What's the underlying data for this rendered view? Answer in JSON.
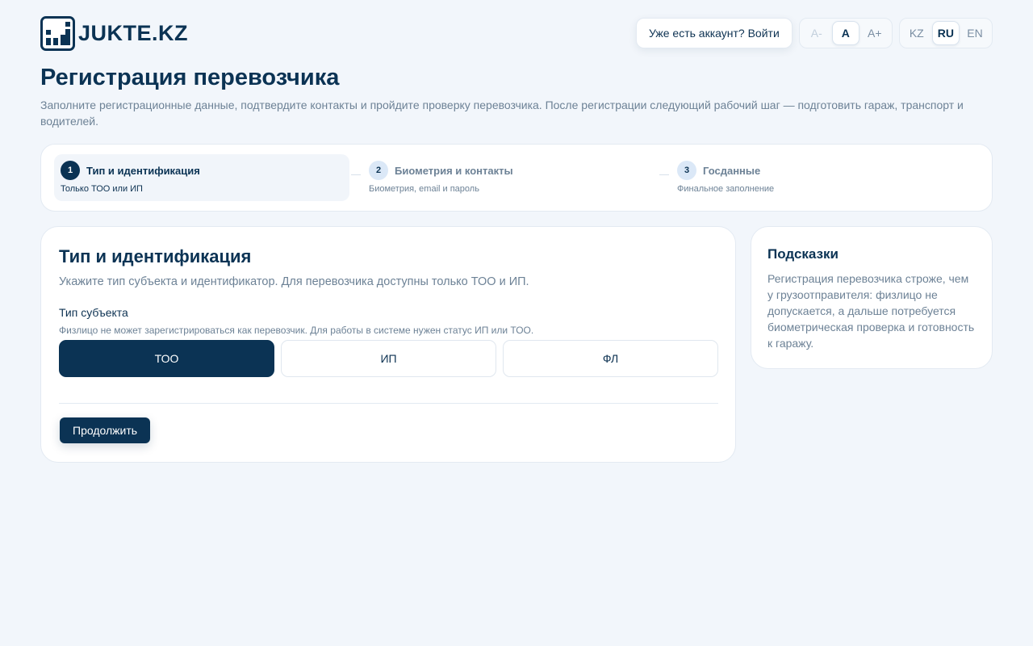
{
  "header": {
    "logo_text": "JUKTE.KZ",
    "login_label": "Уже есть аккаунт? Войти",
    "font_size": {
      "options": [
        "A-",
        "A",
        "A+"
      ],
      "selected": "A"
    },
    "language": {
      "options": [
        "KZ",
        "RU",
        "EN"
      ],
      "selected": "RU"
    }
  },
  "page": {
    "title": "Регистрация перевозчика",
    "description": "Заполните регистрационные данные, подтвердите контакты и пройдите проверку перевозчика. После регистрации следующий рабочий шаг — подготовить гараж, транспорт и водителей."
  },
  "stepper": {
    "steps": [
      {
        "number": "1",
        "title": "Тип и идентификация",
        "subtitle": "Только ТОО или ИП",
        "active": true
      },
      {
        "number": "2",
        "title": "Биометрия и контакты",
        "subtitle": "Биометрия, email и пароль",
        "active": false
      },
      {
        "number": "3",
        "title": "Госданные",
        "subtitle": "Финальное заполнение",
        "active": false
      }
    ]
  },
  "form": {
    "title": "Тип и идентификация",
    "description": "Укажите тип субъекта и идентификатор. Для перевозчика доступны только ТОО и ИП.",
    "subject_type": {
      "label": "Тип субъекта",
      "hint": "Физлицо не может зарегистрироваться как перевозчик. Для работы в системе нужен статус ИП или ТОО.",
      "options": [
        "ТОО",
        "ИП",
        "ФЛ"
      ],
      "selected": "ТОО"
    },
    "continue_label": "Продолжить"
  },
  "hints": {
    "title": "Подсказки",
    "text": "Регистрация перевозчика строже, чем у грузоотправителя: физлицо не допускается, а дальше потребуется биометрическая проверка и готовность к гаражу."
  },
  "colors": {
    "primary": "#0b3354",
    "background": "#f2f6fb",
    "muted_text": "#6d8296",
    "step_badge": "#dbe8f7"
  }
}
